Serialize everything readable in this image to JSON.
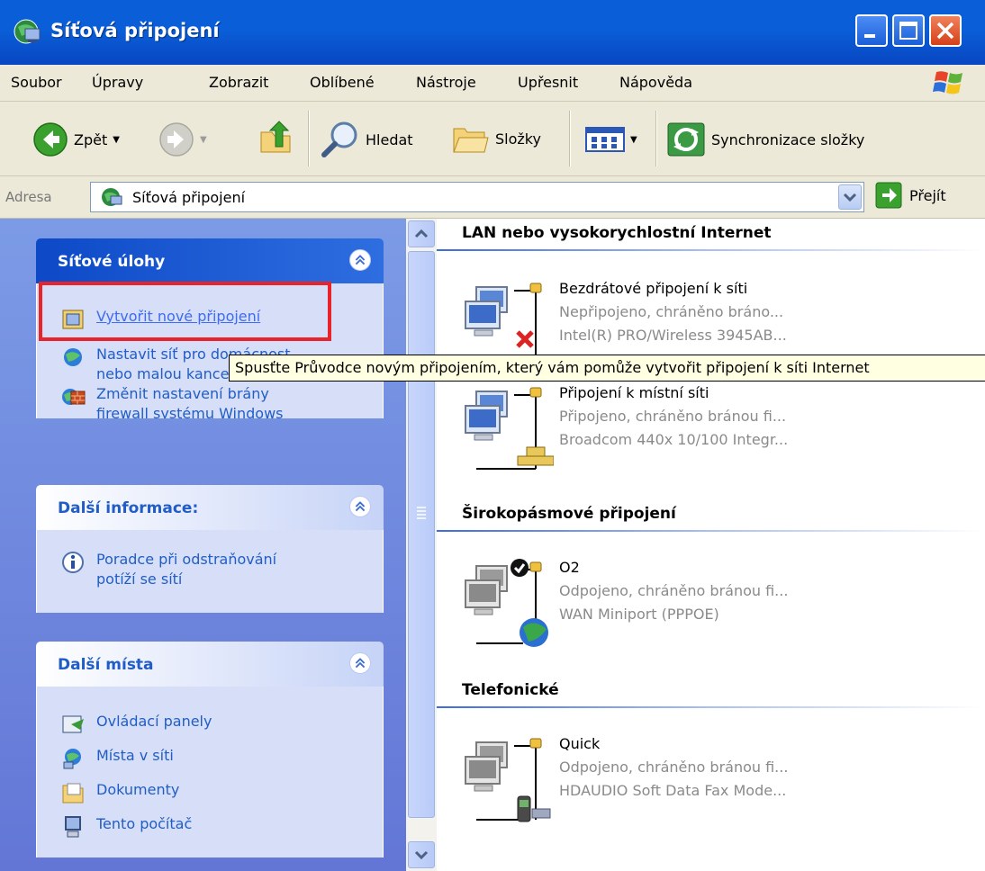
{
  "window": {
    "title": "Síťová připojení"
  },
  "menu": [
    "Soubor",
    "Úpravy",
    "Zobrazit",
    "Oblíbené",
    "Nástroje",
    "Upřesnit",
    "Nápověda"
  ],
  "toolbar": {
    "back_label": "Zpět",
    "search_label": "Hledat",
    "folders_label": "Složky",
    "sync_label": "Synchronizace složky"
  },
  "address": {
    "label": "Adresa",
    "value": "Síťová připojení",
    "go_label": "Přejít"
  },
  "tasks": {
    "network": {
      "title": "Síťové úlohy",
      "items": [
        {
          "label": "Vytvořit nové připojení",
          "icon": "new-connection-icon"
        },
        {
          "label": "Nastavit síť pro domácnost\nnebo malou kancelář",
          "icon": "home-network-icon"
        },
        {
          "label": "Změnit nastavení brány\nfirewall systému Windows",
          "icon": "firewall-icon"
        }
      ]
    },
    "info": {
      "title": "Další informace:",
      "items": [
        {
          "label": "Poradce při odstraňování\npotíží se sítí",
          "icon": "info-icon"
        }
      ]
    },
    "places": {
      "title": "Další místa",
      "items": [
        {
          "label": "Ovládací panely",
          "icon": "control-panel-icon"
        },
        {
          "label": "Místa v síti",
          "icon": "network-places-icon"
        },
        {
          "label": "Dokumenty",
          "icon": "documents-icon"
        },
        {
          "label": "Tento počítač",
          "icon": "my-computer-icon"
        }
      ]
    }
  },
  "groups": {
    "lan": {
      "title": "LAN nebo vysokorychlostní Internet",
      "items": [
        {
          "name": "Bezdrátové připojení k síti",
          "status": "Nepřipojeno, chráněno bráno...",
          "device": "Intel(R) PRO/Wireless 3945AB..."
        },
        {
          "name": "Připojení k místní síti",
          "status": "Připojeno, chráněno bránou fi...",
          "device": "Broadcom 440x 10/100 Integr..."
        }
      ]
    },
    "broadband": {
      "title": "Širokopásmové připojení",
      "items": [
        {
          "name": "O2",
          "status": "Odpojeno, chráněno bránou fi...",
          "device": "WAN Miniport (PPPOE)"
        }
      ]
    },
    "dialup": {
      "title": "Telefonické",
      "items": [
        {
          "name": "Quick",
          "status": "Odpojeno, chráněno bránou fi...",
          "device": "HDAUDIO Soft Data Fax Mode..."
        }
      ]
    }
  },
  "tooltip": "Spusťte Průvodce novým připojením, který vám pomůže vytvořit připojení k síti Internet",
  "colors": {
    "title_blue": "#0a5fd8",
    "task_pane": "#7c9be6",
    "link_blue": "#215dc6",
    "highlight_red": "#e8232a"
  }
}
